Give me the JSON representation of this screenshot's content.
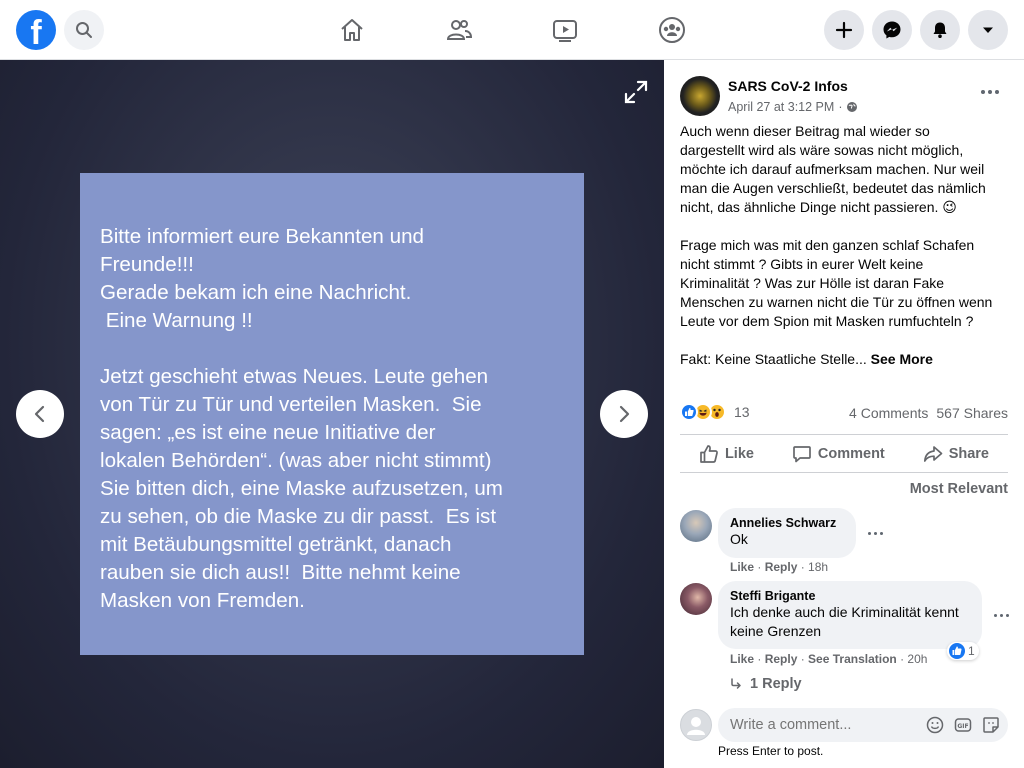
{
  "nav": {
    "logo": "f",
    "tabs": [
      "home",
      "friends",
      "watch",
      "groups"
    ]
  },
  "viewer": {
    "image_text": "Bitte informiert eure Bekannten und\nFreunde!!!\nGerade bekam ich eine Nachricht.\n Eine Warnung !!\n\nJetzt geschieht etwas Neues. Leute gehen\nvon Tür zu Tür und verteilen Masken.  Sie\nsagen: „es ist eine neue Initiative der\nlokalen Behörden“. (was aber nicht stimmt)\nSie bitten dich, eine Maske aufzusetzen, um\nzu sehen, ob die Maske zu dir passt.  Es ist\nmit Betäubungsmittel getränkt, danach\nrauben sie dich aus!!  Bitte nehmt keine\nMasken von Fremden.",
    "image_bg": "#8596cb"
  },
  "post": {
    "page_name": "SARS CoV-2 Infos",
    "timestamp": "April 27 at 3:12 PM",
    "separator": "·",
    "body_1": "Auch wenn dieser Beitrag mal wieder so\ndargestellt wird als wäre sowas nicht möglich,\nmöchte ich darauf aufmerksam machen. Nur weil\nman die Augen verschließt, bedeutet das nämlich\nnicht, das ähnliche Dinge nicht passieren. 😉",
    "body_2": "Frage mich was mit den ganzen schlaf Schafen\nnicht stimmt ? Gibts in eurer Welt keine\nKriminalität ? Was zur Hölle ist daran Fake\nMenschen zu warnen nicht die Tür zu öffnen wenn\nLeute vor dem Spion mit Masken rumfuchteln ?",
    "body_3": "Fakt: Keine Staatliche Stelle... ",
    "see_more": "See More",
    "reaction_count": "13",
    "comments": "4 Comments",
    "shares": "567 Shares",
    "like": "Like",
    "comment": "Comment",
    "share": "Share",
    "sort": "Most Relevant"
  },
  "comments": [
    {
      "name": "Annelies Schwarz",
      "text": "Ok",
      "like": "Like",
      "reply": "Reply",
      "time": "18h"
    },
    {
      "name": "Steffi Brigante",
      "text": "Ich denke auch die Kriminalität kennt\nkeine Grenzen",
      "like": "Like",
      "reply": "Reply",
      "see_translation": "See Translation",
      "time": "20h",
      "likes": "1",
      "replies_link": "1 Reply"
    }
  ],
  "composer": {
    "placeholder": "Write a comment...",
    "hint": "Press Enter to post."
  },
  "colors": {
    "brand": "#1877f2",
    "like_blue": "#1877f2",
    "haha_yellow": "#f7b928"
  }
}
